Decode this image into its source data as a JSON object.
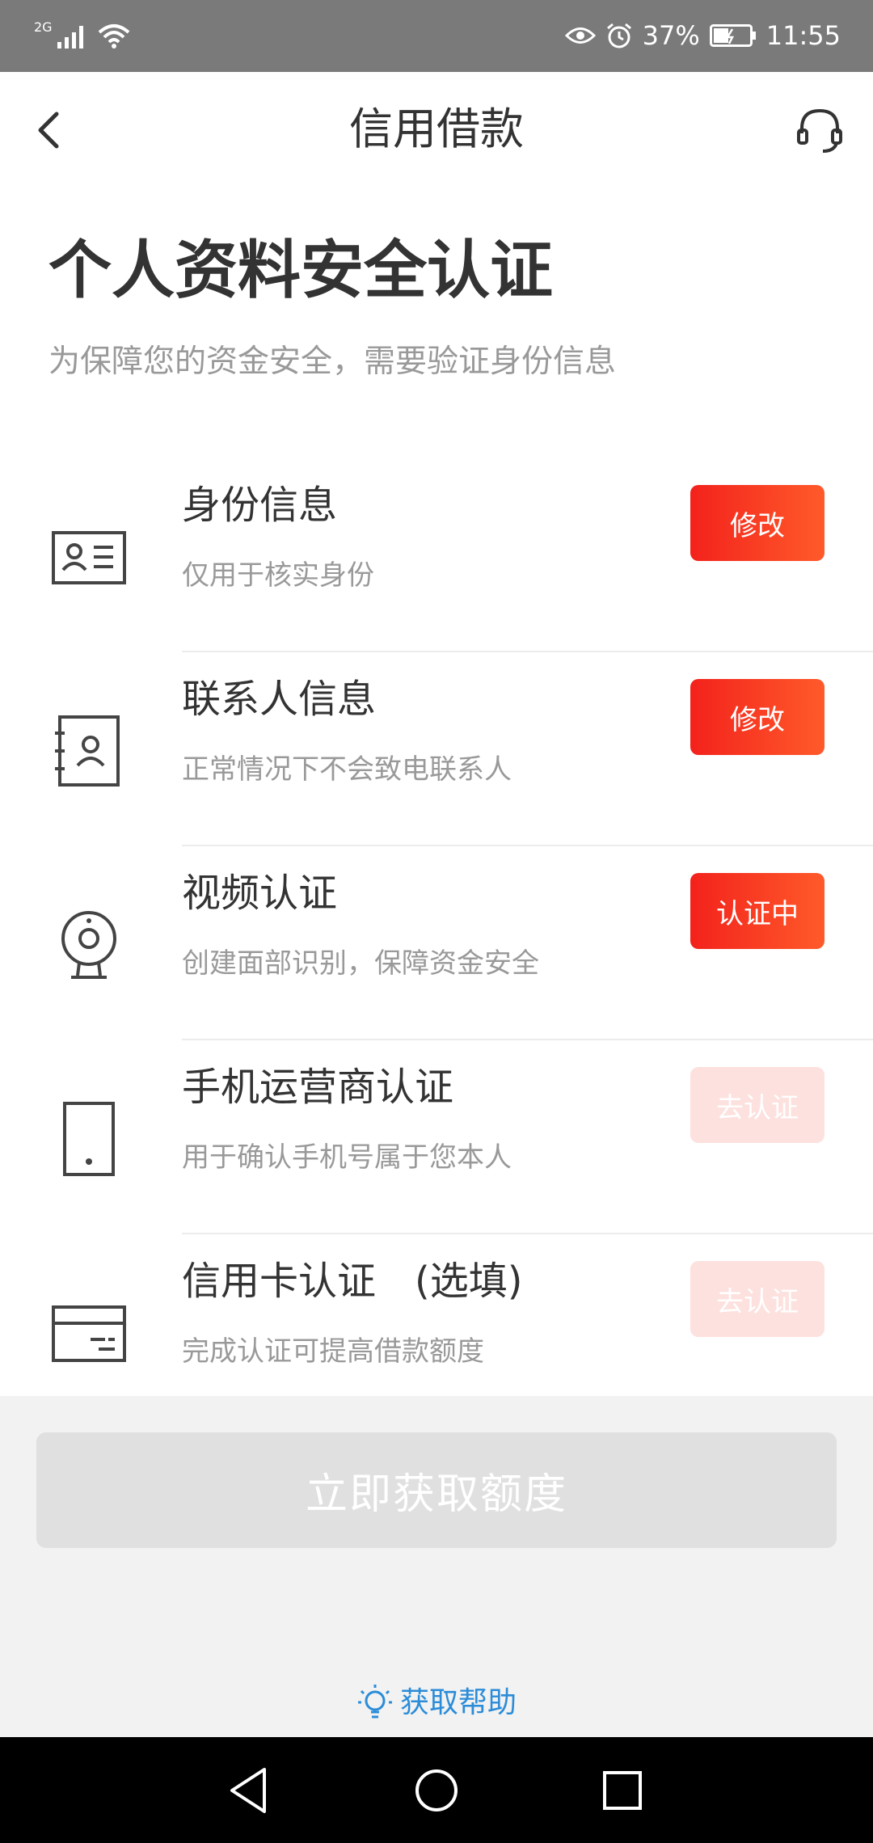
{
  "status_bar": {
    "network_type": "2G",
    "battery_percent": "37%",
    "time": "11:55",
    "icons": [
      "signal-icon",
      "wifi-icon",
      "eye-icon",
      "alarm-icon",
      "battery-icon"
    ]
  },
  "header": {
    "title": "信用借款",
    "back_icon": "chevron-left-icon",
    "support_icon": "headset-icon"
  },
  "intro": {
    "title": "个人资料安全认证",
    "subtitle": "为保障您的资金安全，需要验证身份信息"
  },
  "items": [
    {
      "title": "身份信息",
      "desc": "仅用于核实身份",
      "button": "修改",
      "icon": "id-card-icon",
      "state": "active"
    },
    {
      "title": "联系人信息",
      "desc": "正常情况下不会致电联系人",
      "button": "修改",
      "icon": "contact-book-icon",
      "state": "active"
    },
    {
      "title": "视频认证",
      "desc": "创建面部识别，保障资金安全",
      "button": "认证中",
      "icon": "webcam-icon",
      "state": "active"
    },
    {
      "title": "手机运营商认证",
      "desc": "用于确认手机号属于您本人",
      "button": "去认证",
      "icon": "phone-icon",
      "state": "disabled"
    },
    {
      "title": "信用卡认证　(选填)",
      "desc": "完成认证可提高借款额度",
      "button": "去认证",
      "icon": "credit-card-icon",
      "state": "disabled"
    }
  ],
  "footer": {
    "primary_button": "立即获取额度",
    "help_link": "获取帮助",
    "help_icon": "lightbulb-icon"
  },
  "colors": {
    "accent_start": "#f3221c",
    "accent_end": "#ff5a2a",
    "disabled_button": "#fde1de",
    "help_link": "#2b8cd8",
    "primary_disabled": "#e0e0e0"
  }
}
